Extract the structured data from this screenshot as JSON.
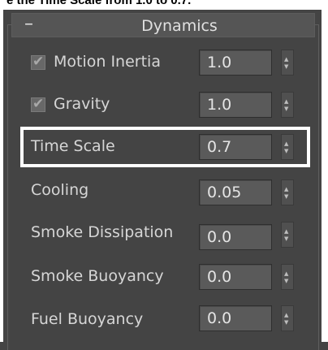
{
  "caption": {
    "text": "e the Time Scale from 1.0 to 0.7."
  },
  "rollout": {
    "collapse_symbol": "–",
    "title": "Dynamics"
  },
  "params": [
    {
      "label": "Motion Inertia",
      "value": "1.0",
      "checkbox": true,
      "checked": true
    },
    {
      "label": "Gravity",
      "value": "1.0",
      "checkbox": true,
      "checked": true
    },
    {
      "label": "Time Scale",
      "value": "0.7",
      "checkbox": false,
      "highlighted": true
    },
    {
      "label": "Cooling",
      "value": "0.05",
      "checkbox": false
    },
    {
      "label": "Smoke Dissipation",
      "value": "0.0",
      "checkbox": false
    },
    {
      "label": "Smoke Buoyancy",
      "value": "0.0",
      "checkbox": false
    },
    {
      "label": "Fuel Buoyancy",
      "value": "0.0",
      "checkbox": false
    }
  ],
  "icons": {
    "check": "check-icon",
    "spinner_up": "spinner-up-icon",
    "spinner_down": "spinner-down-icon"
  },
  "colors": {
    "panel_bg": "#444444",
    "highlight": "#ffffff",
    "field_bg": "#5a5a5a"
  }
}
